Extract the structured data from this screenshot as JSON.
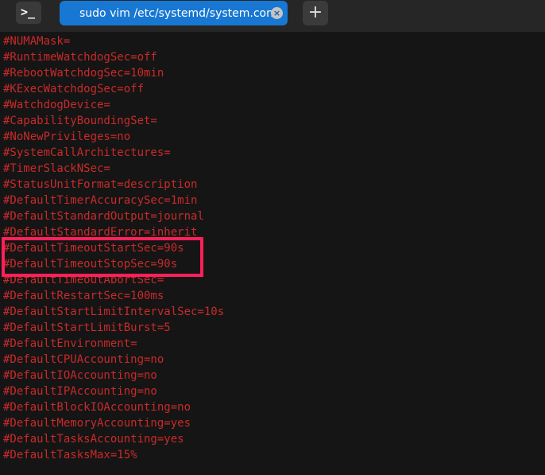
{
  "toolbar": {
    "terminal_icon_glyph": ">_",
    "new_tab_glyph": "+"
  },
  "tab": {
    "title": "sudo vim /etc/systemd/system.conf",
    "close_glyph": "×"
  },
  "editor": {
    "lines": [
      "#NUMAMask=",
      "#RuntimeWatchdogSec=off",
      "#RebootWatchdogSec=10min",
      "#KExecWatchdogSec=off",
      "#WatchdogDevice=",
      "#CapabilityBoundingSet=",
      "#NoNewPrivileges=no",
      "#SystemCallArchitectures=",
      "#TimerSlackNSec=",
      "#StatusUnitFormat=description",
      "#DefaultTimerAccuracySec=1min",
      "#DefaultStandardOutput=journal",
      "#DefaultStandardError=inherit",
      "#DefaultTimeoutStartSec=90s",
      "#DefaultTimeoutStopSec=90s",
      "#DefaultTimeoutAbortSec=",
      "#DefaultRestartSec=100ms",
      "#DefaultStartLimitIntervalSec=10s",
      "#DefaultStartLimitBurst=5",
      "#DefaultEnvironment=",
      "#DefaultCPUAccounting=no",
      "#DefaultIOAccounting=no",
      "#DefaultIPAccounting=no",
      "#DefaultBlockIOAccounting=no",
      "#DefaultMemoryAccounting=yes",
      "#DefaultTasksAccounting=yes",
      "#DefaultTasksMax=15%"
    ]
  },
  "colors": {
    "comment_text": "#c92a2a",
    "highlight_border": "#ff1f5a",
    "tab_active": "#1877d2",
    "background": "#151515"
  }
}
